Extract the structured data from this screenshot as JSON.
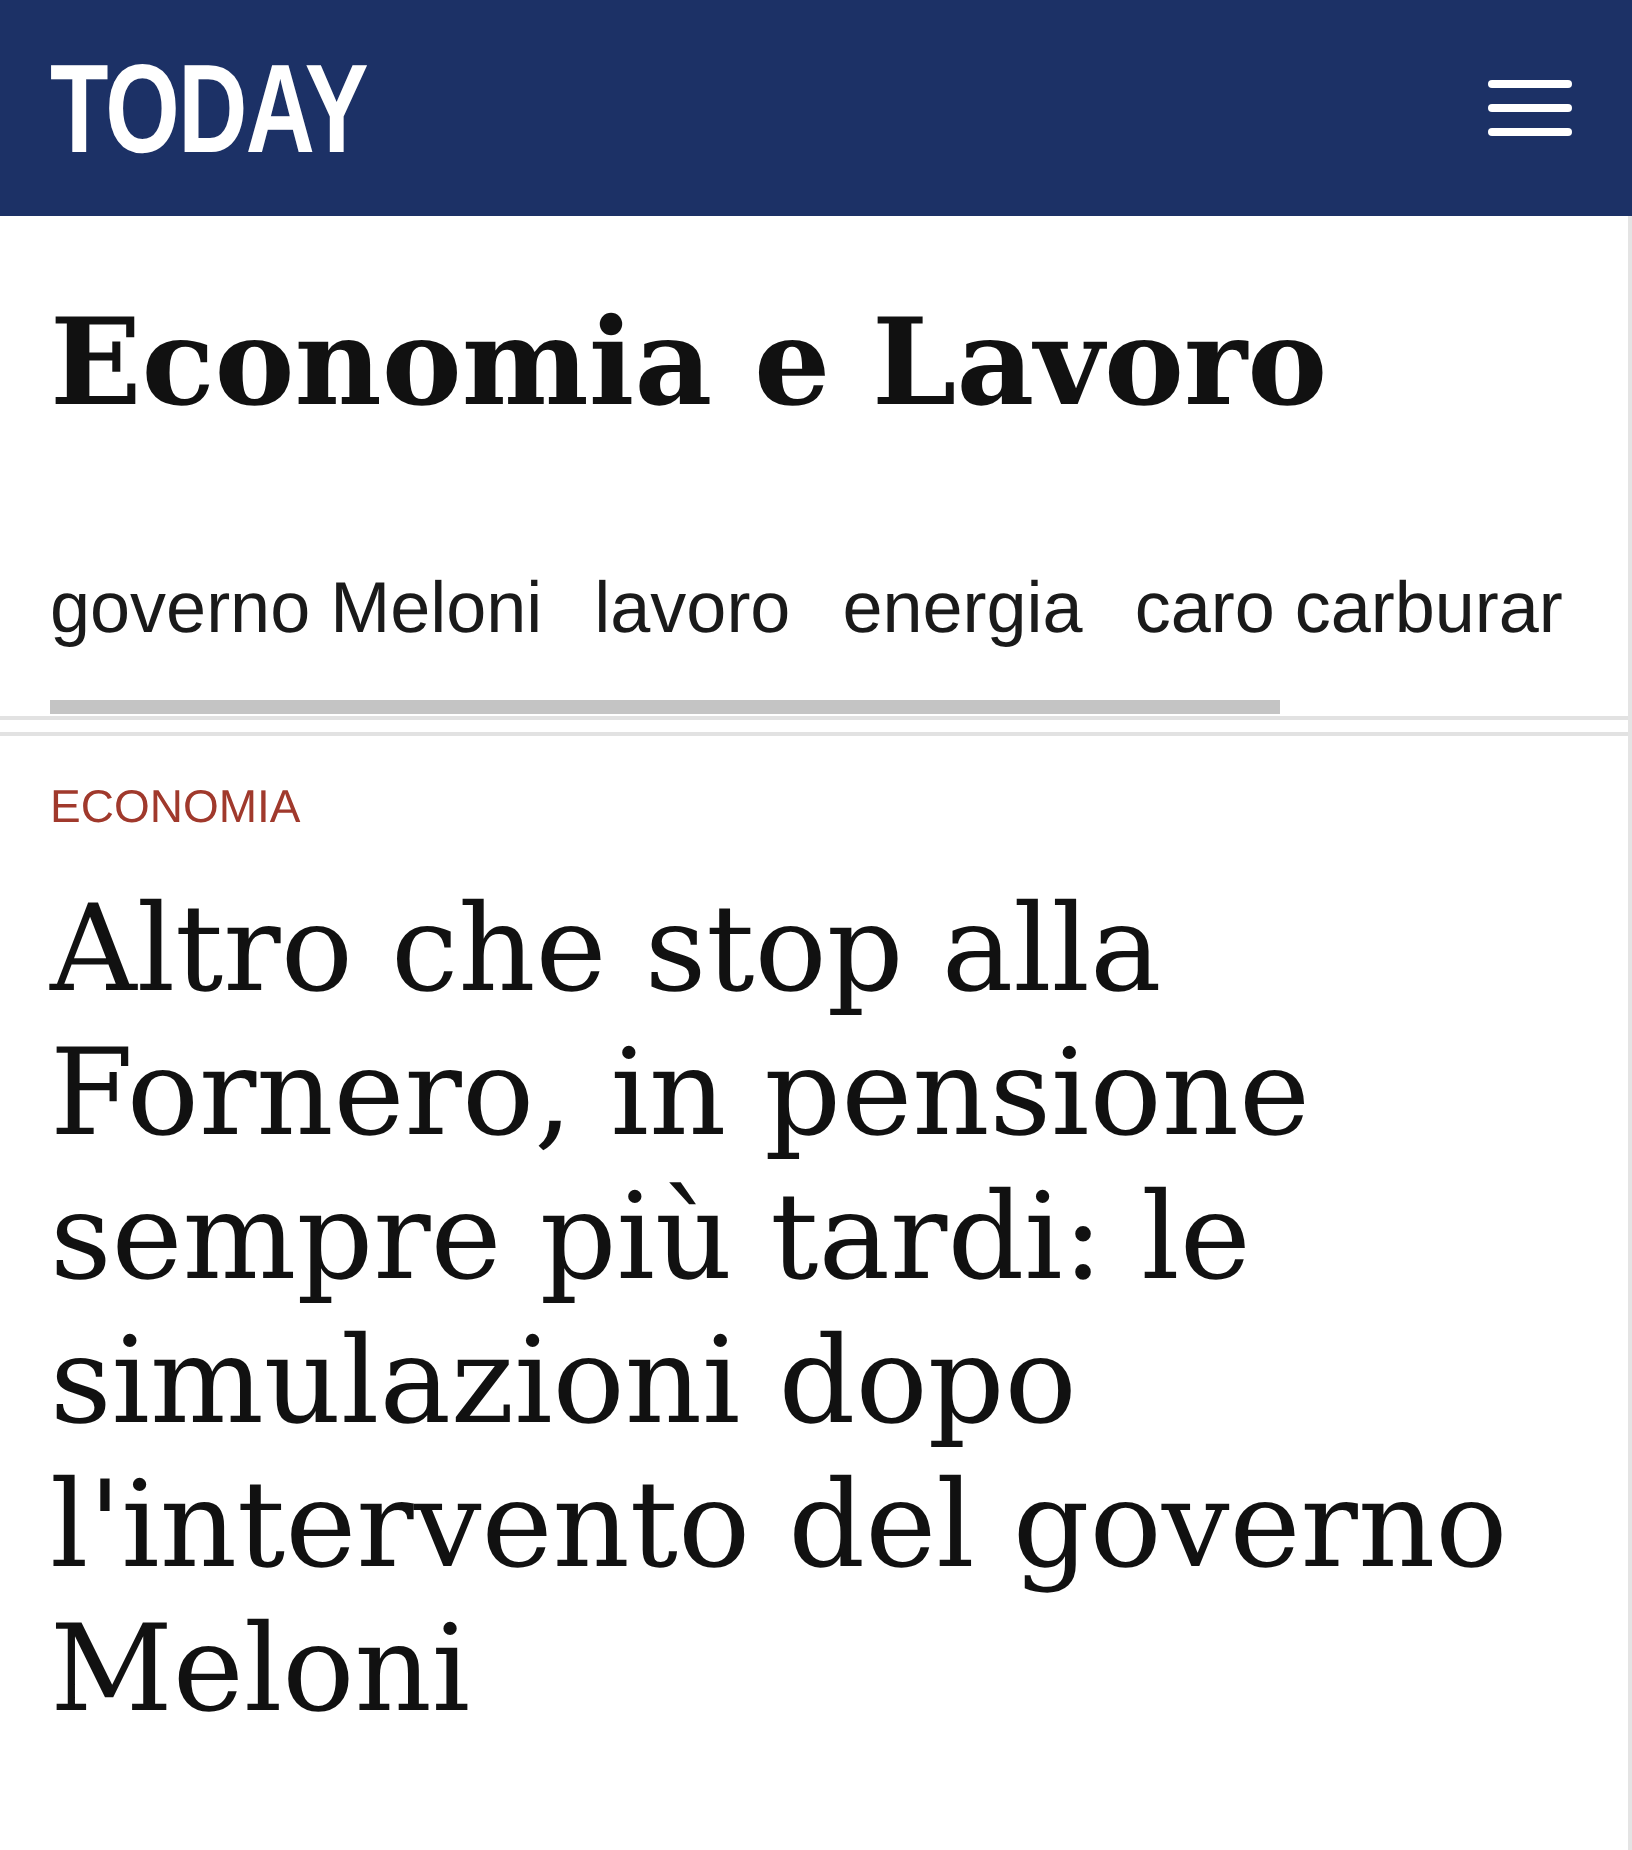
{
  "header": {
    "logo": "TODAY"
  },
  "section": {
    "title": "Economia e Lavoro"
  },
  "tags": [
    {
      "label": "governo Meloni"
    },
    {
      "label": "lavoro"
    },
    {
      "label": "energia"
    },
    {
      "label": "caro carburar"
    }
  ],
  "article": {
    "category": "ECONOMIA",
    "headline": "Altro che stop alla Fornero, in pensione sempre più tardi: le simulazioni dopo l'intervento del governo Meloni"
  }
}
